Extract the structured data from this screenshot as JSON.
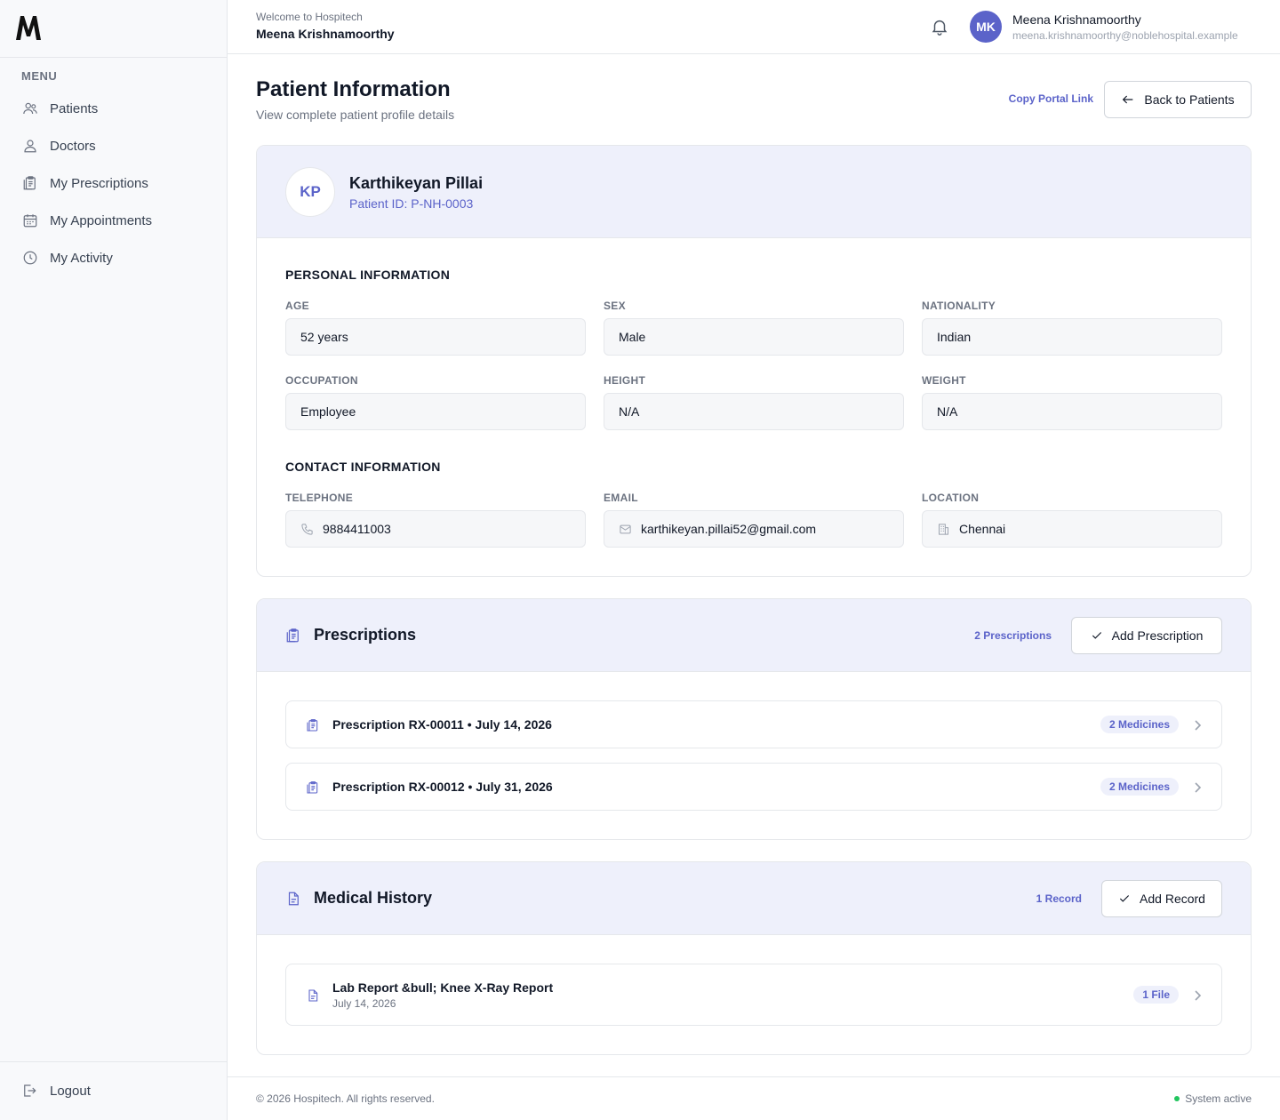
{
  "app": {
    "logo_icon": "m-logo-icon"
  },
  "sidebar": {
    "menu_label": "MENU",
    "items": [
      {
        "label": "Patients",
        "icon": "users-icon"
      },
      {
        "label": "Doctors",
        "icon": "user-icon"
      },
      {
        "label": "My Prescriptions",
        "icon": "clipboard-icon"
      },
      {
        "label": "My Appointments",
        "icon": "calendar-icon"
      },
      {
        "label": "My Activity",
        "icon": "clock-icon"
      }
    ],
    "logout_label": "Logout"
  },
  "header": {
    "welcome": "Welcome to Hospitech",
    "welcome_name": "Meena Krishnamoorthy",
    "user_initials": "MK",
    "user_name": "Meena Krishnamoorthy",
    "user_email": "meena.krishnamoorthy@noblehospital.example"
  },
  "page": {
    "title": "Patient Information",
    "subtitle": "View complete patient profile details",
    "copy_link": "Copy Portal Link",
    "back_label": "Back to Patients"
  },
  "patient": {
    "initials": "KP",
    "name": "Karthikeyan Pillai",
    "id_text": "Patient ID: P-NH-0003",
    "personal_title": "PERSONAL INFORMATION",
    "contact_title": "CONTACT INFORMATION",
    "fields": {
      "age": {
        "label": "AGE",
        "value": "52 years"
      },
      "sex": {
        "label": "SEX",
        "value": "Male"
      },
      "nationality": {
        "label": "NATIONALITY",
        "value": "Indian"
      },
      "occupation": {
        "label": "OCCUPATION",
        "value": "Employee"
      },
      "height": {
        "label": "HEIGHT",
        "value": "N/A"
      },
      "weight": {
        "label": "WEIGHT",
        "value": "N/A"
      },
      "telephone": {
        "label": "TELEPHONE",
        "value": "9884411003"
      },
      "email": {
        "label": "EMAIL",
        "value": "karthikeyan.pillai52@gmail.com"
      },
      "location": {
        "label": "LOCATION",
        "value": "Chennai"
      }
    }
  },
  "prescriptions": {
    "title": "Prescriptions",
    "count": "2 Prescriptions",
    "add_label": "Add Prescription",
    "items": [
      {
        "title": "Prescription RX-00011 • July 14, 2026",
        "badge": "2 Medicines"
      },
      {
        "title": "Prescription RX-00012 • July 31, 2026",
        "badge": "2 Medicines"
      }
    ]
  },
  "medical_history": {
    "title": "Medical History",
    "count": "1 Record",
    "add_label": "Add Record",
    "items": [
      {
        "title": "Lab Report &bull; Knee X-Ray Report",
        "date": "July 14, 2026",
        "badge": "1 File"
      }
    ]
  },
  "footer": {
    "copyright": "© 2026 Hospitech. All rights reserved.",
    "status": "System active"
  },
  "colors": {
    "accent": "#5b63c9",
    "header_band": "#eef0fb",
    "status_green": "#22c55e"
  }
}
